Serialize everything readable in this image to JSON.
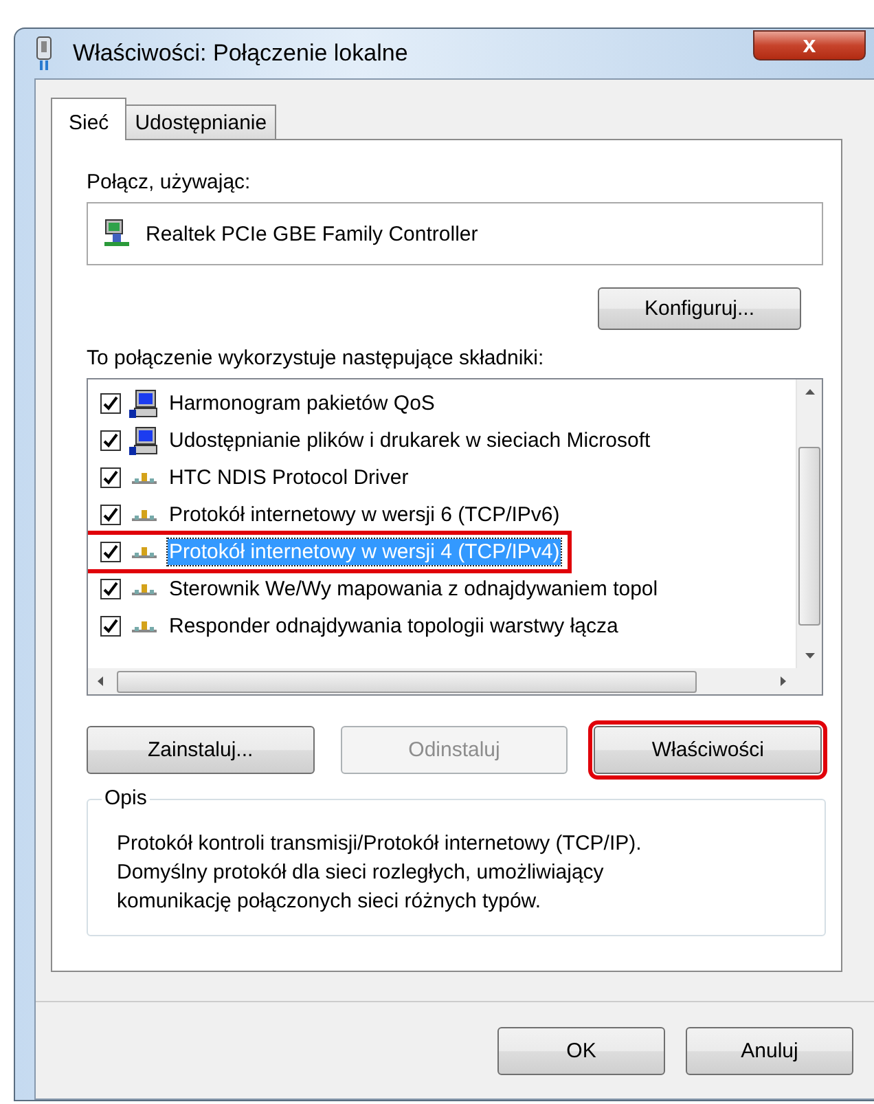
{
  "window": {
    "title": "Właściwości: Połączenie lokalne",
    "close": "x"
  },
  "tabs": [
    {
      "label": "Sieć",
      "selected": true
    },
    {
      "label": "Udostępnianie",
      "selected": false
    }
  ],
  "connect_label": "Połącz, używając:",
  "adapter": "Realtek PCIe GBE Family Controller",
  "configure_button": "Konfiguruj...",
  "components_label": "To połączenie wykorzystuje następujące składniki:",
  "components": [
    {
      "kind": "computer",
      "label": "Harmonogram pakietów QoS",
      "checked": true,
      "selected": false,
      "highlighted": false
    },
    {
      "kind": "computer",
      "label": "Udostępnianie plików i drukarek w sieciach Microsoft",
      "checked": true,
      "selected": false,
      "highlighted": false
    },
    {
      "kind": "protocol",
      "label": "HTC NDIS Protocol Driver",
      "checked": true,
      "selected": false,
      "highlighted": false
    },
    {
      "kind": "protocol",
      "label": "Protokół internetowy w wersji 6 (TCP/IPv6)",
      "checked": true,
      "selected": false,
      "highlighted": false
    },
    {
      "kind": "protocol",
      "label": "Protokół internetowy w wersji 4 (TCP/IPv4)",
      "checked": true,
      "selected": true,
      "highlighted": true
    },
    {
      "kind": "protocol",
      "label": "Sterownik We/Wy mapowania z odnajdywaniem topol",
      "checked": true,
      "selected": false,
      "highlighted": false
    },
    {
      "kind": "protocol",
      "label": "Responder odnajdywania topologii warstwy łącza",
      "checked": true,
      "selected": false,
      "highlighted": false
    }
  ],
  "action_buttons": [
    {
      "label": "Zainstaluj...",
      "disabled": false,
      "highlighted": false
    },
    {
      "label": "Odinstaluj",
      "disabled": true,
      "highlighted": false
    },
    {
      "label": "Właściwości",
      "disabled": false,
      "highlighted": true
    }
  ],
  "description": {
    "title": "Opis",
    "lines": [
      "Protokół kontroli transmisji/Protokół internetowy (TCP/IP).",
      "Domyślny protokół dla sieci rozległych, umożliwiający",
      "komunikację połączonych sieci różnych typów."
    ]
  },
  "dialog_buttons": [
    "OK",
    "Anuluj"
  ]
}
